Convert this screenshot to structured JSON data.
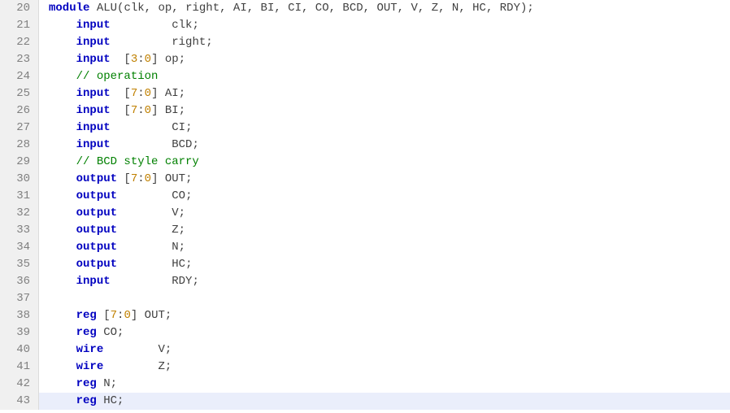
{
  "lines": [
    {
      "n": 20,
      "hl": false,
      "tokens": [
        {
          "cls": "kw",
          "t": "module"
        },
        {
          "cls": "punct",
          "t": " ALU"
        },
        {
          "cls": "punct",
          "t": "("
        },
        {
          "cls": "ident",
          "t": "clk"
        },
        {
          "cls": "punct",
          "t": ", "
        },
        {
          "cls": "ident",
          "t": "op"
        },
        {
          "cls": "punct",
          "t": ", "
        },
        {
          "cls": "ident",
          "t": "right"
        },
        {
          "cls": "punct",
          "t": ", "
        },
        {
          "cls": "ident",
          "t": "AI"
        },
        {
          "cls": "punct",
          "t": ", "
        },
        {
          "cls": "ident",
          "t": "BI"
        },
        {
          "cls": "punct",
          "t": ", "
        },
        {
          "cls": "ident",
          "t": "CI"
        },
        {
          "cls": "punct",
          "t": ", "
        },
        {
          "cls": "ident",
          "t": "CO"
        },
        {
          "cls": "punct",
          "t": ", "
        },
        {
          "cls": "ident",
          "t": "BCD"
        },
        {
          "cls": "punct",
          "t": ", "
        },
        {
          "cls": "ident",
          "t": "OUT"
        },
        {
          "cls": "punct",
          "t": ", "
        },
        {
          "cls": "ident",
          "t": "V"
        },
        {
          "cls": "punct",
          "t": ", "
        },
        {
          "cls": "ident",
          "t": "Z"
        },
        {
          "cls": "punct",
          "t": ", "
        },
        {
          "cls": "ident",
          "t": "N"
        },
        {
          "cls": "punct",
          "t": ", "
        },
        {
          "cls": "ident",
          "t": "HC"
        },
        {
          "cls": "punct",
          "t": ", "
        },
        {
          "cls": "ident",
          "t": "RDY"
        },
        {
          "cls": "punct",
          "t": ")"
        },
        {
          "cls": "punct",
          "t": ";"
        }
      ]
    },
    {
      "n": 21,
      "hl": false,
      "tokens": [
        {
          "cls": "punct",
          "t": "    "
        },
        {
          "cls": "kw",
          "t": "input"
        },
        {
          "cls": "punct",
          "t": "         "
        },
        {
          "cls": "ident",
          "t": "clk"
        },
        {
          "cls": "punct",
          "t": ";"
        }
      ]
    },
    {
      "n": 22,
      "hl": false,
      "tokens": [
        {
          "cls": "punct",
          "t": "    "
        },
        {
          "cls": "kw",
          "t": "input"
        },
        {
          "cls": "punct",
          "t": "         "
        },
        {
          "cls": "ident",
          "t": "right"
        },
        {
          "cls": "punct",
          "t": ";"
        }
      ]
    },
    {
      "n": 23,
      "hl": false,
      "tokens": [
        {
          "cls": "punct",
          "t": "    "
        },
        {
          "cls": "kw",
          "t": "input"
        },
        {
          "cls": "punct",
          "t": "  ["
        },
        {
          "cls": "num",
          "t": "3"
        },
        {
          "cls": "punct",
          "t": ":"
        },
        {
          "cls": "num",
          "t": "0"
        },
        {
          "cls": "punct",
          "t": "] "
        },
        {
          "cls": "ident",
          "t": "op"
        },
        {
          "cls": "punct",
          "t": ";"
        }
      ]
    },
    {
      "n": 24,
      "hl": false,
      "tokens": [
        {
          "cls": "punct",
          "t": "    "
        },
        {
          "cls": "cmt",
          "t": "// operation"
        }
      ]
    },
    {
      "n": 25,
      "hl": false,
      "tokens": [
        {
          "cls": "punct",
          "t": "    "
        },
        {
          "cls": "kw",
          "t": "input"
        },
        {
          "cls": "punct",
          "t": "  ["
        },
        {
          "cls": "num",
          "t": "7"
        },
        {
          "cls": "punct",
          "t": ":"
        },
        {
          "cls": "num",
          "t": "0"
        },
        {
          "cls": "punct",
          "t": "] "
        },
        {
          "cls": "ident",
          "t": "AI"
        },
        {
          "cls": "punct",
          "t": ";"
        }
      ]
    },
    {
      "n": 26,
      "hl": false,
      "tokens": [
        {
          "cls": "punct",
          "t": "    "
        },
        {
          "cls": "kw",
          "t": "input"
        },
        {
          "cls": "punct",
          "t": "  ["
        },
        {
          "cls": "num",
          "t": "7"
        },
        {
          "cls": "punct",
          "t": ":"
        },
        {
          "cls": "num",
          "t": "0"
        },
        {
          "cls": "punct",
          "t": "] "
        },
        {
          "cls": "ident",
          "t": "BI"
        },
        {
          "cls": "punct",
          "t": ";"
        }
      ]
    },
    {
      "n": 27,
      "hl": false,
      "tokens": [
        {
          "cls": "punct",
          "t": "    "
        },
        {
          "cls": "kw",
          "t": "input"
        },
        {
          "cls": "punct",
          "t": "         "
        },
        {
          "cls": "ident",
          "t": "CI"
        },
        {
          "cls": "punct",
          "t": ";"
        }
      ]
    },
    {
      "n": 28,
      "hl": false,
      "tokens": [
        {
          "cls": "punct",
          "t": "    "
        },
        {
          "cls": "kw",
          "t": "input"
        },
        {
          "cls": "punct",
          "t": "         "
        },
        {
          "cls": "ident",
          "t": "BCD"
        },
        {
          "cls": "punct",
          "t": ";"
        }
      ]
    },
    {
      "n": 29,
      "hl": false,
      "tokens": [
        {
          "cls": "punct",
          "t": "    "
        },
        {
          "cls": "cmt",
          "t": "// BCD style carry"
        }
      ]
    },
    {
      "n": 30,
      "hl": false,
      "tokens": [
        {
          "cls": "punct",
          "t": "    "
        },
        {
          "cls": "kw",
          "t": "output"
        },
        {
          "cls": "punct",
          "t": " ["
        },
        {
          "cls": "num",
          "t": "7"
        },
        {
          "cls": "punct",
          "t": ":"
        },
        {
          "cls": "num",
          "t": "0"
        },
        {
          "cls": "punct",
          "t": "] "
        },
        {
          "cls": "ident",
          "t": "OUT"
        },
        {
          "cls": "punct",
          "t": ";"
        }
      ]
    },
    {
      "n": 31,
      "hl": false,
      "tokens": [
        {
          "cls": "punct",
          "t": "    "
        },
        {
          "cls": "kw",
          "t": "output"
        },
        {
          "cls": "punct",
          "t": "        "
        },
        {
          "cls": "ident",
          "t": "CO"
        },
        {
          "cls": "punct",
          "t": ";"
        }
      ]
    },
    {
      "n": 32,
      "hl": false,
      "tokens": [
        {
          "cls": "punct",
          "t": "    "
        },
        {
          "cls": "kw",
          "t": "output"
        },
        {
          "cls": "punct",
          "t": "        "
        },
        {
          "cls": "ident",
          "t": "V"
        },
        {
          "cls": "punct",
          "t": ";"
        }
      ]
    },
    {
      "n": 33,
      "hl": false,
      "tokens": [
        {
          "cls": "punct",
          "t": "    "
        },
        {
          "cls": "kw",
          "t": "output"
        },
        {
          "cls": "punct",
          "t": "        "
        },
        {
          "cls": "ident",
          "t": "Z"
        },
        {
          "cls": "punct",
          "t": ";"
        }
      ]
    },
    {
      "n": 34,
      "hl": false,
      "tokens": [
        {
          "cls": "punct",
          "t": "    "
        },
        {
          "cls": "kw",
          "t": "output"
        },
        {
          "cls": "punct",
          "t": "        "
        },
        {
          "cls": "ident",
          "t": "N"
        },
        {
          "cls": "punct",
          "t": ";"
        }
      ]
    },
    {
      "n": 35,
      "hl": false,
      "tokens": [
        {
          "cls": "punct",
          "t": "    "
        },
        {
          "cls": "kw",
          "t": "output"
        },
        {
          "cls": "punct",
          "t": "        "
        },
        {
          "cls": "ident",
          "t": "HC"
        },
        {
          "cls": "punct",
          "t": ";"
        }
      ]
    },
    {
      "n": 36,
      "hl": false,
      "tokens": [
        {
          "cls": "punct",
          "t": "    "
        },
        {
          "cls": "kw",
          "t": "input"
        },
        {
          "cls": "punct",
          "t": "         "
        },
        {
          "cls": "ident",
          "t": "RDY"
        },
        {
          "cls": "punct",
          "t": ";"
        }
      ]
    },
    {
      "n": 37,
      "hl": false,
      "tokens": []
    },
    {
      "n": 38,
      "hl": false,
      "tokens": [
        {
          "cls": "punct",
          "t": "    "
        },
        {
          "cls": "kw",
          "t": "reg"
        },
        {
          "cls": "punct",
          "t": " ["
        },
        {
          "cls": "num",
          "t": "7"
        },
        {
          "cls": "punct",
          "t": ":"
        },
        {
          "cls": "num",
          "t": "0"
        },
        {
          "cls": "punct",
          "t": "] "
        },
        {
          "cls": "ident",
          "t": "OUT"
        },
        {
          "cls": "punct",
          "t": ";"
        }
      ]
    },
    {
      "n": 39,
      "hl": false,
      "tokens": [
        {
          "cls": "punct",
          "t": "    "
        },
        {
          "cls": "kw",
          "t": "reg"
        },
        {
          "cls": "punct",
          "t": " "
        },
        {
          "cls": "ident",
          "t": "CO"
        },
        {
          "cls": "punct",
          "t": ";"
        }
      ]
    },
    {
      "n": 40,
      "hl": false,
      "tokens": [
        {
          "cls": "punct",
          "t": "    "
        },
        {
          "cls": "kw",
          "t": "wire"
        },
        {
          "cls": "punct",
          "t": "        "
        },
        {
          "cls": "ident",
          "t": "V"
        },
        {
          "cls": "punct",
          "t": ";"
        }
      ]
    },
    {
      "n": 41,
      "hl": false,
      "tokens": [
        {
          "cls": "punct",
          "t": "    "
        },
        {
          "cls": "kw",
          "t": "wire"
        },
        {
          "cls": "punct",
          "t": "        "
        },
        {
          "cls": "ident",
          "t": "Z"
        },
        {
          "cls": "punct",
          "t": ";"
        }
      ]
    },
    {
      "n": 42,
      "hl": false,
      "tokens": [
        {
          "cls": "punct",
          "t": "    "
        },
        {
          "cls": "kw",
          "t": "reg"
        },
        {
          "cls": "punct",
          "t": " "
        },
        {
          "cls": "ident",
          "t": "N"
        },
        {
          "cls": "punct",
          "t": ";"
        }
      ]
    },
    {
      "n": 43,
      "hl": true,
      "tokens": [
        {
          "cls": "punct",
          "t": "    "
        },
        {
          "cls": "kw",
          "t": "reg"
        },
        {
          "cls": "punct",
          "t": " "
        },
        {
          "cls": "ident",
          "t": "HC"
        },
        {
          "cls": "punct",
          "t": ";"
        }
      ]
    }
  ]
}
